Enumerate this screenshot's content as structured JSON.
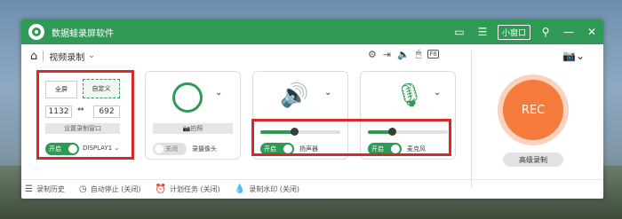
{
  "app": {
    "title": "数据蛙录屏软件",
    "mini_label": "小窗口"
  },
  "nav": {
    "mode_label": "视频录制"
  },
  "screen": {
    "fullscreen_label": "全屏",
    "custom_label": "自定义",
    "width": "1132",
    "height": "692",
    "set_window_label": "设置录制窗口",
    "toggle_label": "开启",
    "display": "DISPLAY1"
  },
  "camera": {
    "snapshot_label": "拍照",
    "toggle_label": "关闭",
    "name": "录摄像头"
  },
  "speaker": {
    "toggle_label": "开启",
    "name": "扬声器",
    "volume": 0.42
  },
  "mic": {
    "toggle_label": "开启",
    "name": "麦克风",
    "volume": 0.3
  },
  "rec": {
    "label": "REC",
    "advanced_label": "高级录制"
  },
  "bottom": {
    "history": "录制历史",
    "auto_stop": "自动停止 (关闭)",
    "schedule": "计划任务 (关闭)",
    "watermark": "录制水印 (关闭)"
  },
  "colors": {
    "accent": "#2f9a55",
    "rec": "#f57b3c",
    "highlight": "#d62a2a"
  }
}
